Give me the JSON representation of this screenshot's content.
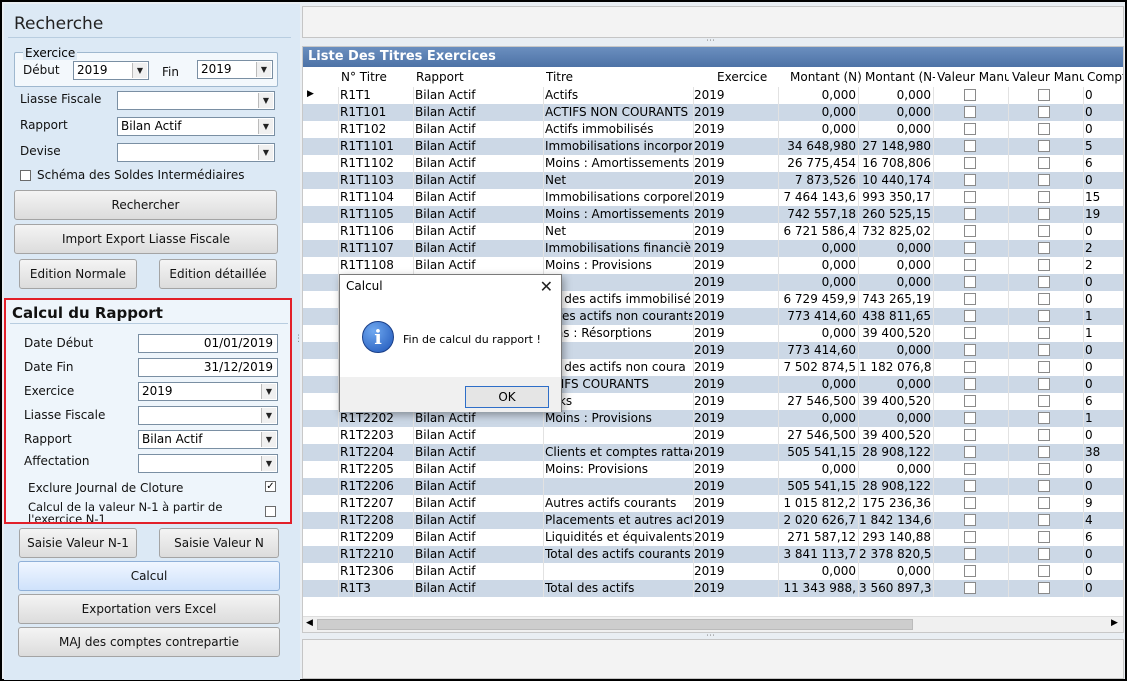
{
  "search": {
    "title": "Recherche",
    "exercice_legend": "Exercice",
    "debut_label": "Début",
    "debut_value": "2019",
    "fin_label": "Fin",
    "fin_value": "2019",
    "liasse_label": "Liasse Fiscale",
    "liasse_value": "",
    "rapport_label": "Rapport",
    "rapport_value": "Bilan Actif",
    "devise_label": "Devise",
    "devise_value": "",
    "schema_label": "Schéma des Soldes Intermédiaires",
    "rechercher_btn": "Rechercher",
    "import_btn": "Import Export Liasse Fiscale",
    "edition_normale_btn": "Edition Normale",
    "edition_detaillee_btn": "Edition détaillée"
  },
  "calcul": {
    "title": "Calcul du Rapport",
    "date_debut_label": "Date Début",
    "date_debut_value": "01/01/2019",
    "date_fin_label": "Date Fin",
    "date_fin_value": "31/12/2019",
    "exercice_label": "Exercice",
    "exercice_value": "2019",
    "liasse_label": "Liasse Fiscale",
    "liasse_value": "",
    "rapport_label": "Rapport",
    "rapport_value": "Bilan Actif",
    "affectation_label": "Affectation",
    "affectation_value": "",
    "exclure_label": "Exclure Journal de Cloture",
    "exclure_checked": "✓",
    "calcul_n1_label_1": "Calcul de la valeur N-1 à partir de",
    "calcul_n1_label_2": "l'exercice N-1"
  },
  "actions": {
    "saisie_n1": "Saisie Valeur N-1",
    "saisie_n": "Saisie Valeur N",
    "calcul": "Calcul",
    "export_excel": "Exportation vers Excel",
    "maj": "MAJ des comptes contrepartie"
  },
  "grid": {
    "title": "Liste Des Titres  Exercices",
    "headers": [
      "N° Titre",
      "Rapport",
      "Titre",
      "Exercice",
      "Montant (N)",
      "Montant (N-",
      "Valeur Manu",
      "Valeur Manu",
      "Compt"
    ],
    "rows": [
      {
        "no": "R1T1",
        "rapport": "Bilan Actif",
        "titre": "Actifs",
        "ex": "2019",
        "mn": "0,000",
        "mn1": "0,000",
        "c": "0"
      },
      {
        "no": "R1T101",
        "rapport": "Bilan Actif",
        "titre": "ACTIFS NON COURANTS",
        "ex": "2019",
        "mn": "0,000",
        "mn1": "0,000",
        "c": "0"
      },
      {
        "no": "R1T102",
        "rapport": "Bilan Actif",
        "titre": "Actifs immobilisés",
        "ex": "2019",
        "mn": "0,000",
        "mn1": "0,000",
        "c": "0"
      },
      {
        "no": "R1T1101",
        "rapport": "Bilan Actif",
        "titre": "Immobilisations incorpore",
        "ex": "2019",
        "mn": "34 648,980",
        "mn1": "27 148,980",
        "c": "5"
      },
      {
        "no": "R1T1102",
        "rapport": "Bilan Actif",
        "titre": "Moins : Amortissements",
        "ex": "2019",
        "mn": "26 775,454",
        "mn1": "16 708,806",
        "c": "6"
      },
      {
        "no": "R1T1103",
        "rapport": "Bilan Actif",
        "titre": "Net",
        "ex": "2019",
        "mn": "7 873,526",
        "mn1": "10 440,174",
        "c": "0"
      },
      {
        "no": "R1T1104",
        "rapport": "Bilan Actif",
        "titre": "Immobilisations corporell",
        "ex": "2019",
        "mn": "7 464 143,6",
        "mn1": "993 350,17",
        "c": "15"
      },
      {
        "no": "R1T1105",
        "rapport": "Bilan Actif",
        "titre": "Moins : Amortissements",
        "ex": "2019",
        "mn": "742 557,18",
        "mn1": "260 525,15",
        "c": "19"
      },
      {
        "no": "R1T1106",
        "rapport": "Bilan Actif",
        "titre": "Net",
        "ex": "2019",
        "mn": "6 721 586,4",
        "mn1": "732 825,02",
        "c": "0"
      },
      {
        "no": "R1T1107",
        "rapport": "Bilan Actif",
        "titre": "Immobilisations financière",
        "ex": "2019",
        "mn": "0,000",
        "mn1": "0,000",
        "c": "2"
      },
      {
        "no": "R1T1108",
        "rapport": "Bilan Actif",
        "titre": "Moins : Provisions",
        "ex": "2019",
        "mn": "0,000",
        "mn1": "0,000",
        "c": "2"
      },
      {
        "no": "",
        "rapport": "",
        "titre": "",
        "ex": "2019",
        "mn": "0,000",
        "mn1": "0,000",
        "c": "0"
      },
      {
        "no": "",
        "rapport": "",
        "titre": "tal des actifs immobilisé",
        "ex": "2019",
        "mn": "6 729 459,9",
        "mn1": "743 265,19",
        "c": "0"
      },
      {
        "no": "",
        "rapport": "",
        "titre": "utres actifs non courants",
        "ex": "2019",
        "mn": "773 414,60",
        "mn1": "438 811,65",
        "c": "1"
      },
      {
        "no": "",
        "rapport": "",
        "titre": "oins : Résorptions",
        "ex": "2019",
        "mn": "0,000",
        "mn1": "39 400,520",
        "c": "1"
      },
      {
        "no": "",
        "rapport": "",
        "titre": "t",
        "ex": "2019",
        "mn": "773 414,60",
        "mn1": "0,000",
        "c": "0"
      },
      {
        "no": "",
        "rapport": "",
        "titre": "tal des actifs non coura",
        "ex": "2019",
        "mn": "7 502 874,5",
        "mn1": "1 182 076,8",
        "c": "0"
      },
      {
        "no": "",
        "rapport": "",
        "titre": "CTIFS COURANTS",
        "ex": "2019",
        "mn": "0,000",
        "mn1": "0,000",
        "c": "0"
      },
      {
        "no": "",
        "rapport": "",
        "titre": "ocks",
        "ex": "2019",
        "mn": "27 546,500",
        "mn1": "39 400,520",
        "c": "6"
      },
      {
        "no": "R1T2202",
        "rapport": "Bilan Actif",
        "titre": "Moins : Provisions",
        "ex": "2019",
        "mn": "0,000",
        "mn1": "0,000",
        "c": "1"
      },
      {
        "no": "R1T2203",
        "rapport": "Bilan Actif",
        "titre": "",
        "ex": "2019",
        "mn": "27 546,500",
        "mn1": "39 400,520",
        "c": "0"
      },
      {
        "no": "R1T2204",
        "rapport": "Bilan Actif",
        "titre": "Clients et comptes rattach",
        "ex": "2019",
        "mn": "505 541,15",
        "mn1": "28 908,122",
        "c": "38"
      },
      {
        "no": "R1T2205",
        "rapport": "Bilan Actif",
        "titre": "Moins: Provisions",
        "ex": "2019",
        "mn": "0,000",
        "mn1": "0,000",
        "c": "0"
      },
      {
        "no": "R1T2206",
        "rapport": "Bilan Actif",
        "titre": "",
        "ex": "2019",
        "mn": "505 541,15",
        "mn1": "28 908,122",
        "c": "0"
      },
      {
        "no": "R1T2207",
        "rapport": "Bilan Actif",
        "titre": "Autres actifs courants",
        "ex": "2019",
        "mn": "1 015 812,2",
        "mn1": "175 236,36",
        "c": "9"
      },
      {
        "no": "R1T2208",
        "rapport": "Bilan Actif",
        "titre": "Placements et autres actif",
        "ex": "2019",
        "mn": "2 020 626,7",
        "mn1": "1 842 134,6",
        "c": "4"
      },
      {
        "no": "R1T2209",
        "rapport": "Bilan Actif",
        "titre": "Liquidités et équivalents d",
        "ex": "2019",
        "mn": "271 587,12",
        "mn1": "293 140,88",
        "c": "6"
      },
      {
        "no": "R1T2210",
        "rapport": "Bilan Actif",
        "titre": "Total des actifs courants",
        "ex": "2019",
        "mn": "3 841 113,7",
        "mn1": "2 378 820,5",
        "c": "0"
      },
      {
        "no": "R1T2306",
        "rapport": "Bilan Actif",
        "titre": "",
        "ex": "2019",
        "mn": "0,000",
        "mn1": "0,000",
        "c": "0"
      },
      {
        "no": "R1T3",
        "rapport": "Bilan Actif",
        "titre": "Total des actifs",
        "ex": "2019",
        "mn": "11 343 988,",
        "mn1": "3 560 897,3",
        "c": "0"
      }
    ]
  },
  "dialog": {
    "title": "Calcul",
    "message": "Fin de calcul du rapport !",
    "ok": "OK",
    "close": "✕",
    "icon": "info-icon"
  }
}
